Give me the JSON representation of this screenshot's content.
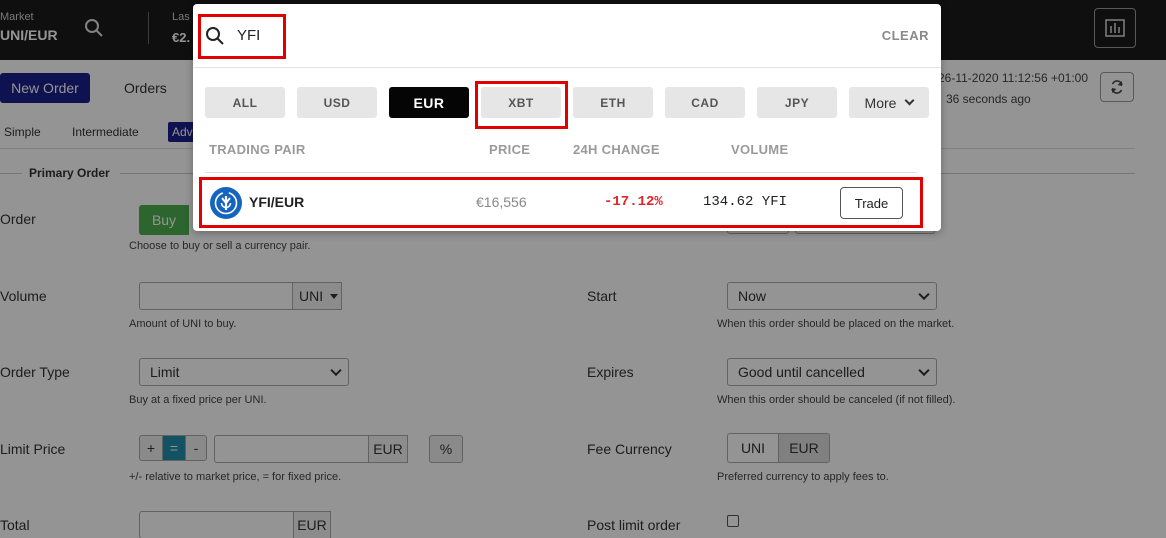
{
  "topbar": {
    "market_label": "Market",
    "market_value": "UNI/EUR",
    "last_label": "Las",
    "last_value": "€2."
  },
  "subnav": {
    "new_order": "New Order",
    "orders": "Orders",
    "timestamp": "26-11-2020 11:12:56 +01:00",
    "ago": "36 seconds ago"
  },
  "modes": {
    "simple": "Simple",
    "intermediate": "Intermediate",
    "advanced": "Adv"
  },
  "form": {
    "section_title": "Primary Order",
    "order_label": "Order",
    "buy": "Buy",
    "order_hint": "Choose to buy or sell a currency pair.",
    "volume_label": "Volume",
    "volume_unit": "UNI",
    "volume_hint": "Amount of UNI to buy.",
    "order_type_label": "Order Type",
    "order_type_value": "Limit",
    "order_type_hint": "Buy at a fixed price per UNI.",
    "limit_price_label": "Limit Price",
    "plus": "+",
    "equals": "=",
    "minus": "-",
    "limit_unit": "EUR",
    "percent": "%",
    "limit_hint": "+/- relative to market price, = for fixed price.",
    "total_label": "Total",
    "total_unit": "EUR",
    "start_label": "Start",
    "start_value": "Now",
    "start_hint": "When this order should be placed on the market.",
    "expires_label": "Expires",
    "expires_value": "Good until cancelled",
    "expires_hint": "When this order should be canceled (if not filled).",
    "fee_label": "Fee Currency",
    "fee_uni": "UNI",
    "fee_eur": "EUR",
    "fee_hint": "Preferred currency to apply fees to.",
    "post_limit_label": "Post limit order"
  },
  "popup": {
    "search_value": "YFI",
    "clear": "CLEAR",
    "tabs": [
      {
        "label": "ALL"
      },
      {
        "label": "USD"
      },
      {
        "label": "EUR"
      },
      {
        "label": "XBT"
      },
      {
        "label": "ETH"
      },
      {
        "label": "CAD"
      },
      {
        "label": "JPY"
      },
      {
        "label": "More"
      }
    ],
    "active_tab": "EUR",
    "columns": {
      "pair": "TRADING PAIR",
      "price": "PRICE",
      "change": "24H CHANGE",
      "volume": "VOLUME"
    },
    "rows": [
      {
        "pair": "YFI/EUR",
        "price": "€16,556",
        "change": "-17.12%",
        "volume": "134.62 YFI",
        "action": "Trade"
      }
    ]
  },
  "colors": {
    "brand": "#1b1f8a",
    "negative": "#e0262c",
    "highlight": "#e00000",
    "buy": "#4caf50"
  }
}
